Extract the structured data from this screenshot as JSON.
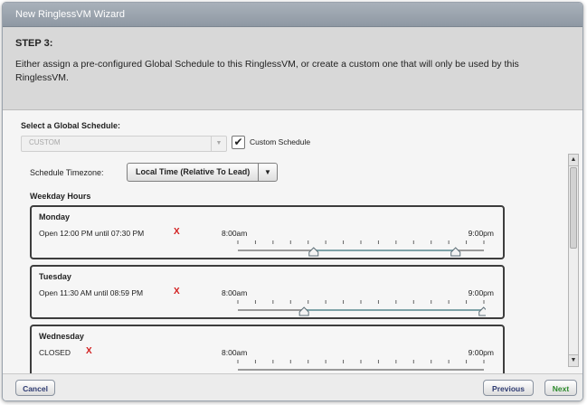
{
  "window": {
    "title": "New RinglessVM Wizard"
  },
  "header": {
    "step": "STEP 3:",
    "description": "Either assign a pre-configured Global Schedule to this RinglessVM, or create a custom one that will only be used by this RinglessVM."
  },
  "schedule": {
    "select_label": "Select a Global Schedule:",
    "selected_value": "CUSTOM",
    "custom_checked": true,
    "custom_label": "Custom Schedule",
    "timezone_label": "Schedule Timezone:",
    "timezone_value": "Local Time (Relative To Lead)",
    "weekday_label": "Weekday Hours"
  },
  "days": [
    {
      "name": "Monday",
      "hours": "Open 12:00 PM until 07:30 PM",
      "remove": "X",
      "start_label": "8:00am",
      "end_label": "9:00pm",
      "open_fraction": 0.308,
      "close_fraction": 0.885,
      "tick_count": 14
    },
    {
      "name": "Tuesday",
      "hours": "Open 11:30 AM until 08:59 PM",
      "remove": "X",
      "start_label": "8:00am",
      "end_label": "9:00pm",
      "open_fraction": 0.269,
      "close_fraction": 0.999,
      "tick_count": 14
    },
    {
      "name": "Wednesday",
      "hours": "CLOSED",
      "remove": "X",
      "start_label": "8:00am",
      "end_label": "9:00pm"
    }
  ],
  "footer": {
    "cancel_label": "Cancel",
    "previous_label": "Previous",
    "next_label": "Next"
  },
  "colors": {
    "accent_text": "#2e3b72",
    "next_text": "#2b8a2b",
    "remove_x": "#d21e1e",
    "track": "#7fa3a8"
  }
}
